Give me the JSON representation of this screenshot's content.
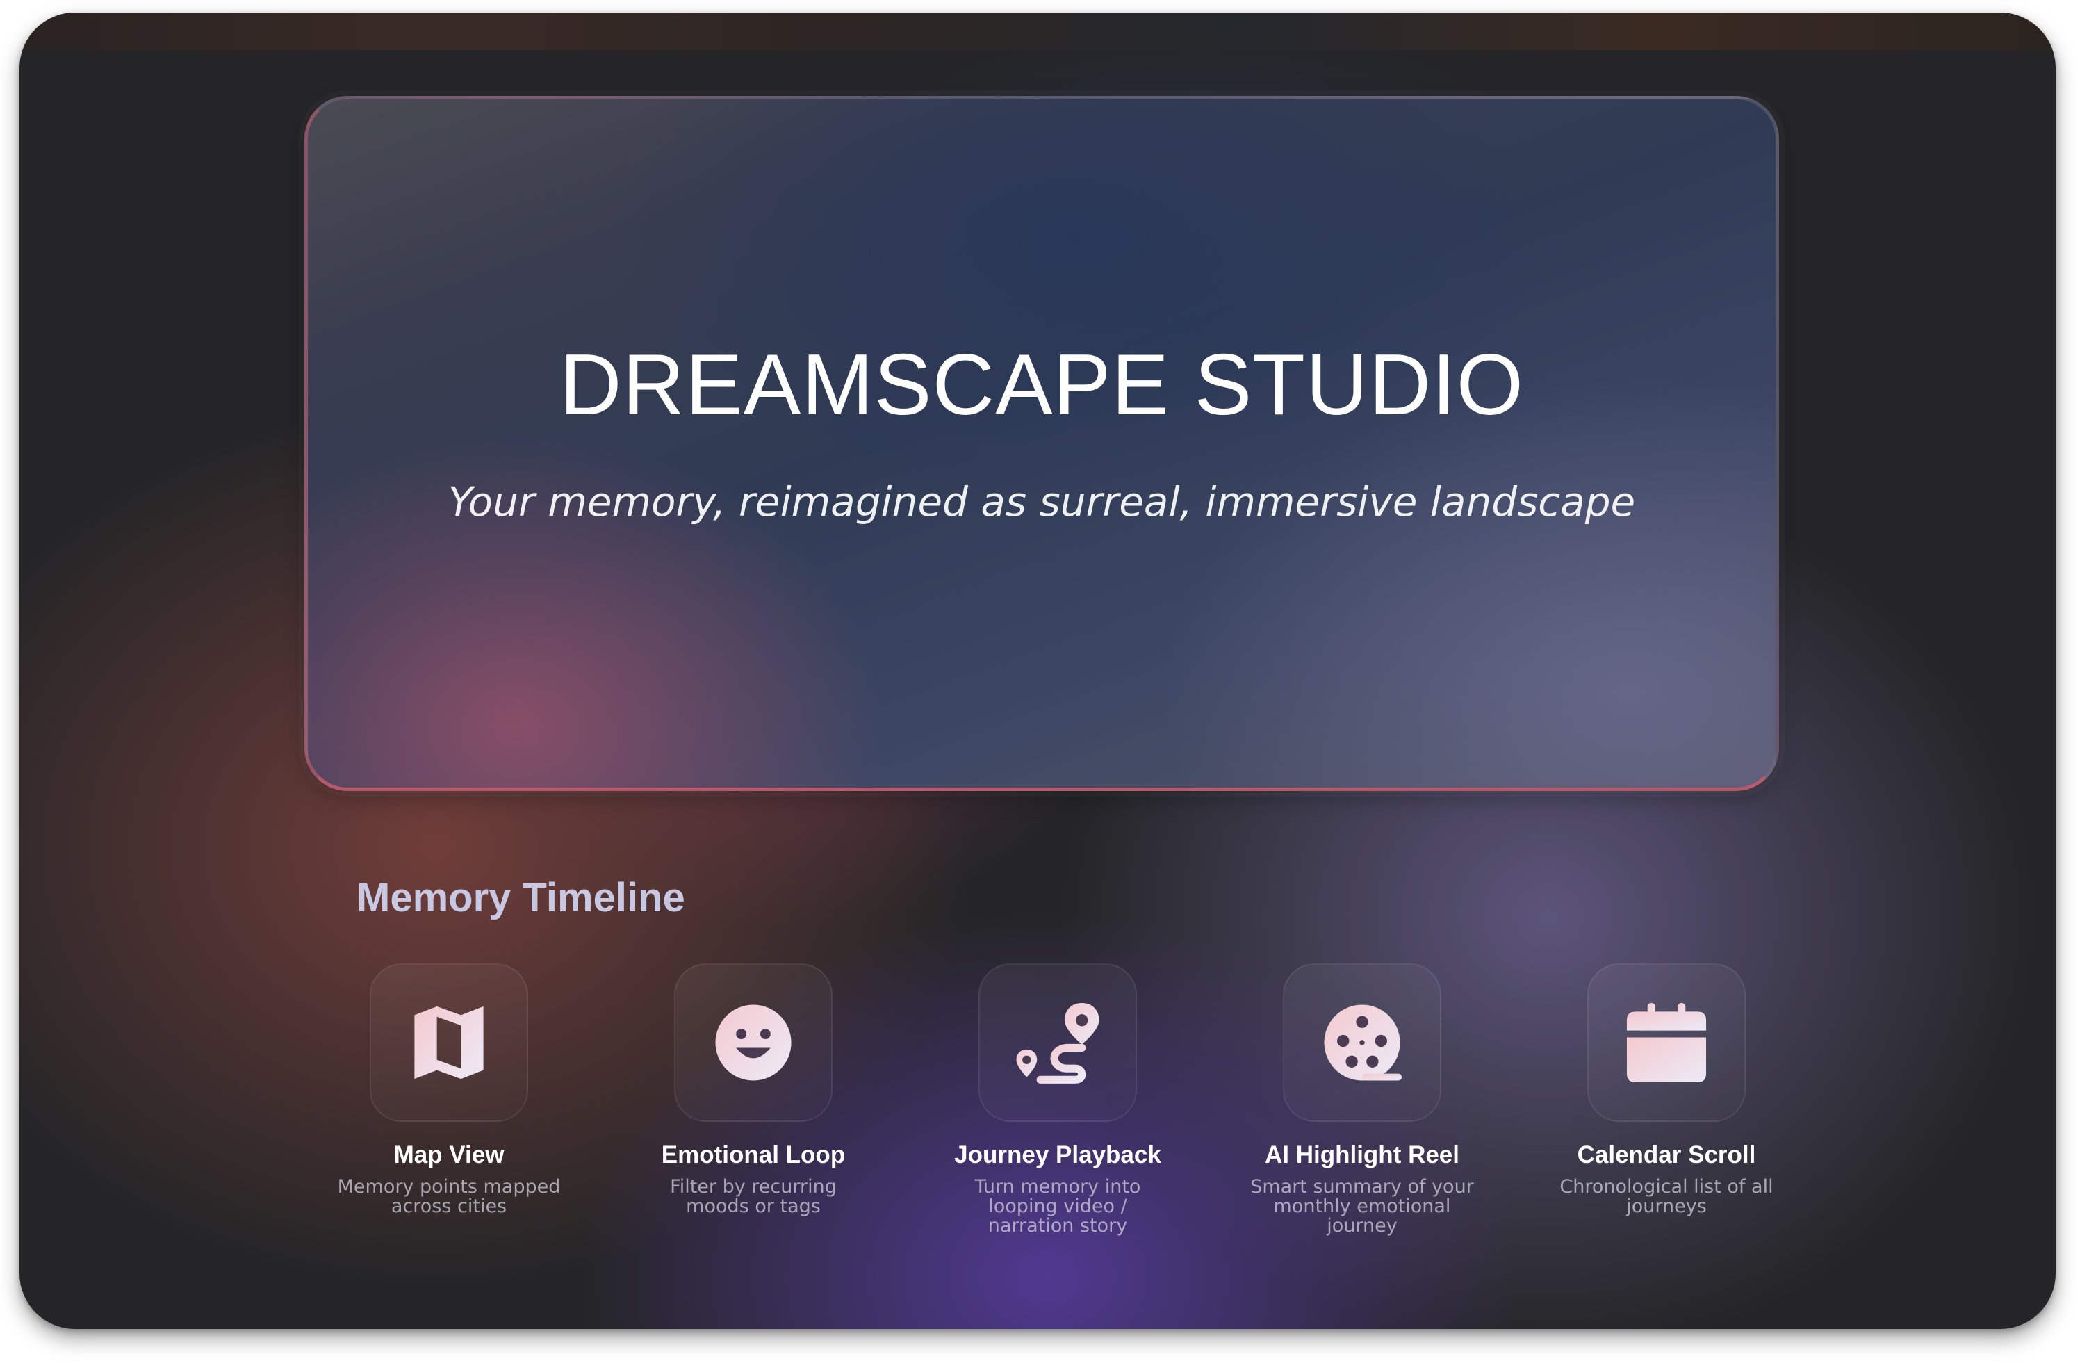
{
  "hero": {
    "title": "DREAMSCAPE STUDIO",
    "subtitle": "Your memory, reimagined as surreal, immersive landscape"
  },
  "timeline": {
    "title": "Memory Timeline",
    "features": [
      {
        "icon": "map-icon",
        "title": "Map View",
        "description": "Memory points mapped across cities"
      },
      {
        "icon": "smiley-icon",
        "title": "Emotional Loop",
        "description": "Filter by recurring moods or tags"
      },
      {
        "icon": "route-icon",
        "title": "Journey Playback",
        "description": "Turn memory into looping video / narration story"
      },
      {
        "icon": "film-reel-icon",
        "title": "AI Highlight Reel",
        "description": "Smart summary of your monthly emotional journey"
      },
      {
        "icon": "calendar-icon",
        "title": "Calendar Scroll",
        "description": "Chronological list of all journeys"
      }
    ]
  },
  "colors": {
    "icon_gradient_start": "#f4c9cf",
    "icon_gradient_end": "#eceaf6",
    "accent_border": "#c05a6e"
  }
}
